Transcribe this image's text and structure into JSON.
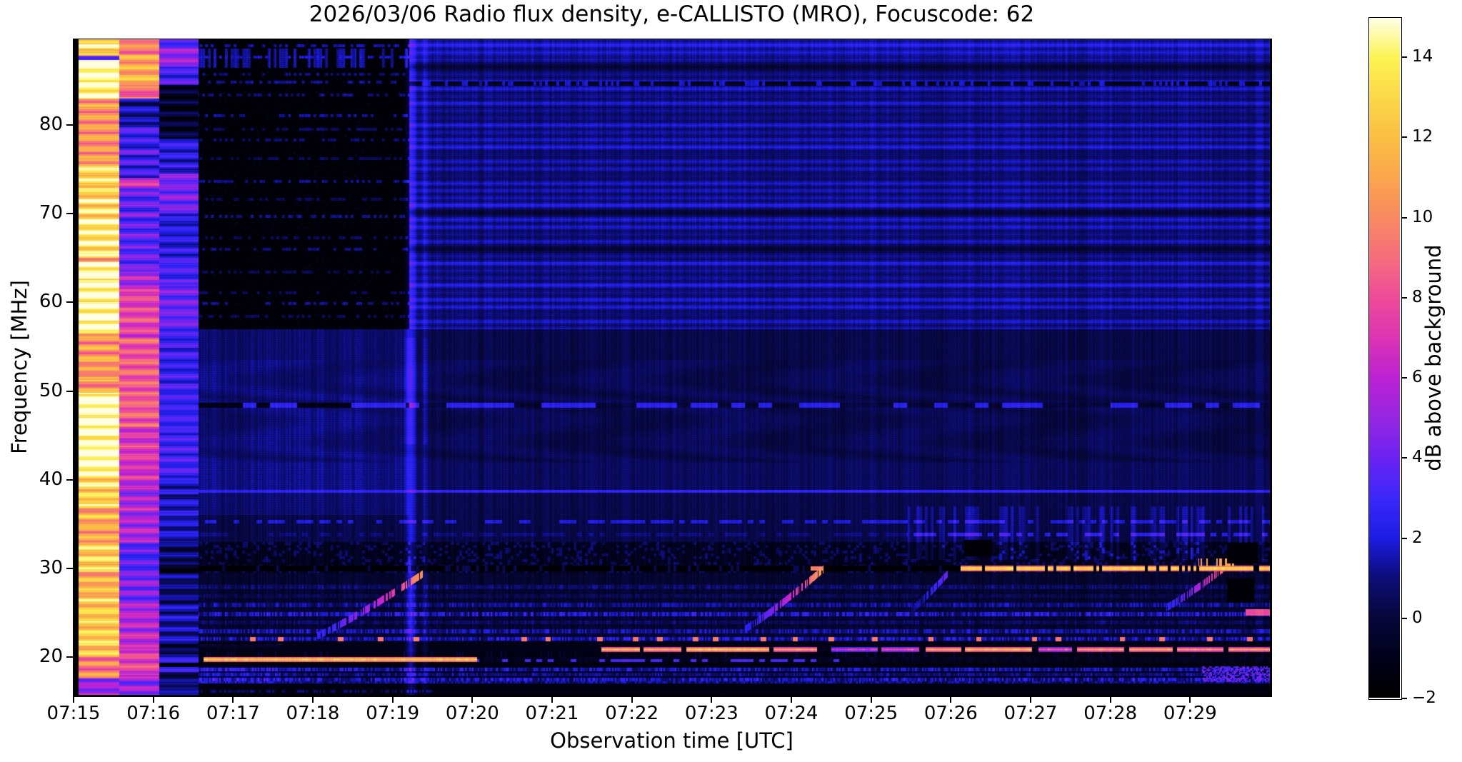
{
  "title": "2026/03/06  Radio flux density, e-CALLISTO (MRO), Focuscode: 62",
  "xlabel": "Observation time [UTC]",
  "ylabel": "Frequency [MHz]",
  "colorbar_label": "dB above background",
  "chart_data": {
    "type": "heatmap",
    "subtype": "solar-radio-spectrogram",
    "title": "2026/03/06  Radio flux density, e-CALLISTO (MRO), Focuscode: 62",
    "date": "2026/03/06",
    "station": "MRO",
    "focuscode": "62",
    "x": {
      "label": "Observation time [UTC]",
      "start_min": 0,
      "end_min": 15,
      "tick_labels": [
        "07:15",
        "07:16",
        "07:17",
        "07:18",
        "07:19",
        "07:20",
        "07:21",
        "07:22",
        "07:23",
        "07:24",
        "07:25",
        "07:26",
        "07:27",
        "07:28",
        "07:29"
      ],
      "tick_minutes": [
        0,
        1,
        2,
        3,
        4,
        5,
        6,
        7,
        8,
        9,
        10,
        11,
        12,
        13,
        14
      ]
    },
    "y": {
      "label": "Frequency [MHz]",
      "top_mhz": 89.65,
      "bottom_mhz": 15.75,
      "ticks": [
        20,
        30,
        40,
        50,
        60,
        70,
        80
      ]
    },
    "z": {
      "label": "dB above background",
      "min": -2,
      "max": 15,
      "ticks": [
        {
          "v": 14,
          "label": "14"
        },
        {
          "v": 12,
          "label": "12"
        },
        {
          "v": 10,
          "label": "10"
        },
        {
          "v": 8,
          "label": "8"
        },
        {
          "v": 6,
          "label": "6"
        },
        {
          "v": 4,
          "label": "4"
        },
        {
          "v": 2,
          "label": "2"
        },
        {
          "v": 0,
          "label": "0"
        },
        {
          "v": -2,
          "label": "−2"
        }
      ],
      "colormap_stops": [
        [
          -2,
          "#000000"
        ],
        [
          -1,
          "#02021a"
        ],
        [
          0,
          "#07073c"
        ],
        [
          1,
          "#0d0d7a"
        ],
        [
          2,
          "#1d1de4"
        ],
        [
          3,
          "#3c28fa"
        ],
        [
          4,
          "#6c23f2"
        ],
        [
          5,
          "#9727e2"
        ],
        [
          6,
          "#bc22d4"
        ],
        [
          7,
          "#dc35b4"
        ],
        [
          8,
          "#ee4b9a"
        ],
        [
          9,
          "#f66e7e"
        ],
        [
          10,
          "#f98a62"
        ],
        [
          11,
          "#fba64e"
        ],
        [
          12,
          "#fbbf44"
        ],
        [
          13,
          "#fcd84a"
        ],
        [
          14,
          "#fdf452"
        ],
        [
          15,
          "#ffffe6"
        ]
      ]
    },
    "data_start_min": 0.063,
    "calibration_columns": [
      {
        "name": "saturated-bright",
        "t0": 0.063,
        "t1": 0.575,
        "bands": [
          [
            89.1,
            89.7,
            11.5
          ],
          [
            88.5,
            89.1,
            15
          ],
          [
            87.8,
            88.5,
            11
          ],
          [
            87.3,
            87.8,
            4
          ],
          [
            84.6,
            87.3,
            15
          ],
          [
            84.1,
            84.6,
            13.5
          ],
          [
            83.0,
            84.1,
            15
          ],
          [
            75.6,
            83.0,
            10.5
          ],
          [
            69.8,
            75.6,
            13
          ],
          [
            65.0,
            69.8,
            13.5
          ],
          [
            64.5,
            65.0,
            11
          ],
          [
            56.5,
            64.5,
            15
          ],
          [
            49.8,
            56.5,
            10.5
          ],
          [
            40.5,
            49.8,
            15
          ],
          [
            36.9,
            40.5,
            13
          ],
          [
            32.9,
            36.9,
            11
          ],
          [
            29.6,
            32.9,
            12.5
          ],
          [
            27.2,
            29.6,
            11
          ],
          [
            20.0,
            27.2,
            12.5
          ],
          [
            17.6,
            20.0,
            9.5
          ],
          [
            15.7,
            17.6,
            5
          ]
        ]
      },
      {
        "name": "medium-bright",
        "t0": 0.575,
        "t1": 1.075,
        "bands": [
          [
            87.9,
            89.7,
            9.5
          ],
          [
            86.0,
            87.9,
            11
          ],
          [
            84.5,
            86.0,
            11.5
          ],
          [
            83.0,
            84.5,
            9
          ],
          [
            80.0,
            83.0,
            1.2
          ],
          [
            74.0,
            80.0,
            2.8
          ],
          [
            72.8,
            74.0,
            6.5
          ],
          [
            63.5,
            72.8,
            3.5
          ],
          [
            61.5,
            63.5,
            5.5
          ],
          [
            56.0,
            61.5,
            7.5
          ],
          [
            46.0,
            56.0,
            8.5
          ],
          [
            40.0,
            46.0,
            7
          ],
          [
            33.0,
            40.0,
            5.5
          ],
          [
            29.5,
            33.0,
            3.5
          ],
          [
            26.0,
            29.5,
            4.5
          ],
          [
            21.0,
            26.0,
            6
          ],
          [
            18.0,
            21.0,
            7.5
          ],
          [
            15.7,
            18.0,
            5
          ]
        ]
      },
      {
        "name": "faint-blue",
        "t0": 1.075,
        "t1": 1.567,
        "bands": [
          [
            88.6,
            89.7,
            3.5
          ],
          [
            86.5,
            88.6,
            5
          ],
          [
            84.5,
            86.5,
            3
          ],
          [
            78.5,
            84.5,
            -0.5
          ],
          [
            74.5,
            78.5,
            2.2
          ],
          [
            70.0,
            74.5,
            4.2
          ],
          [
            65.0,
            70.0,
            2.2
          ],
          [
            62.0,
            65.0,
            3.2
          ],
          [
            57.0,
            62.0,
            4
          ],
          [
            40.0,
            57.0,
            2.8
          ],
          [
            33.0,
            40.0,
            1.8
          ],
          [
            30.5,
            33.0,
            0.5
          ],
          [
            29.5,
            30.5,
            -1.2
          ],
          [
            26.0,
            29.5,
            0.8
          ],
          [
            21.5,
            26.0,
            1.5
          ],
          [
            20.3,
            21.5,
            -0.5
          ],
          [
            19.4,
            20.3,
            2.2
          ],
          [
            18.9,
            19.4,
            -0.8
          ],
          [
            18.3,
            18.9,
            2.5
          ],
          [
            17.0,
            18.3,
            0.3
          ],
          [
            15.7,
            17.0,
            1.2
          ]
        ]
      }
    ],
    "quiet_black_zone": {
      "t0": 1.567,
      "t1": 4.205,
      "f_min": 57,
      "f_max": 90,
      "level": -1.7
    },
    "upper_left_dotted_rows": [
      {
        "f": 88.9,
        "v": 1.5
      },
      {
        "f": 87.6,
        "v": 1.8
      },
      {
        "f": 85.7,
        "v": 1.0
      },
      {
        "f": 84.8,
        "v": 1.3
      },
      {
        "f": 83.4,
        "v": 1.1
      },
      {
        "f": 81.0,
        "v": 1.4
      },
      {
        "f": 79.5,
        "v": 0.7
      },
      {
        "f": 78.3,
        "v": 0.9
      },
      {
        "f": 76.2,
        "v": 0.5
      },
      {
        "f": 73.6,
        "v": 1.2
      },
      {
        "f": 71.6,
        "v": 0.5
      },
      {
        "f": 69.7,
        "v": 1.3
      },
      {
        "f": 67.3,
        "v": 0.6
      },
      {
        "f": 66.0,
        "v": 1.0
      },
      {
        "f": 63.4,
        "v": 0.5
      },
      {
        "f": 61.1,
        "v": 0.6
      },
      {
        "f": 59.9,
        "v": 1.2
      },
      {
        "f": 58.4,
        "v": 0.6
      }
    ],
    "upper_right_stripes": {
      "t0": 4.205,
      "f_min": 57,
      "f_max": 89.6,
      "spacing_mhz": 0.82,
      "base_level": 0.5,
      "amp_min": 0.3,
      "amp_max": 1.95
    },
    "mid_band_wavy": {
      "f_min": 42,
      "f_max": 53.5,
      "base_left": 1.1,
      "base_right": 0.55,
      "arc_depth": 0.5
    },
    "rfi_row_48": {
      "f": 48.4,
      "dash_period_min": 0.17,
      "left_level": 2.6,
      "right_level": 2.4
    },
    "light_row_38_7": {
      "f": 38.7,
      "v": 2.6
    },
    "dashed_rows": [
      {
        "f": 35.3,
        "v": 2.0,
        "t0": 1.6
      },
      {
        "f": 33.8,
        "v": 2.4,
        "t0": 10.45,
        "v_before": 1.0
      }
    ],
    "dark_row_30": {
      "f_min": 29.7,
      "f_max": 30.35,
      "level": -1.85
    },
    "speckle_rows_low": [
      {
        "f": 27.9,
        "v": 1.0
      },
      {
        "f": 26.9,
        "v": 0.7
      },
      {
        "f": 25.9,
        "v": 1.4
      },
      {
        "f": 24.85,
        "v": 2.0
      },
      {
        "f": 23.9,
        "v": 0.9
      },
      {
        "f": 22.9,
        "v": 1.6
      },
      {
        "f": 22.05,
        "v": 1.9
      },
      {
        "f": 18.6,
        "v": 1.8
      },
      {
        "f": 18.05,
        "v": 1.2
      },
      {
        "f": 17.5,
        "v": 1.9
      },
      {
        "f": 17.15,
        "v": 1.3
      }
    ],
    "vertical_streaks": [
      {
        "t": 4.225,
        "w": 0.09,
        "dv": 2.2
      },
      {
        "t": 4.41,
        "w": 0.055,
        "dv": 0.9
      }
    ],
    "drifting_bursts": [
      {
        "t0": 3.05,
        "f0": 22.4,
        "t1": 4.4,
        "f1": 29.5,
        "vmax": 10.5
      },
      {
        "t0": 8.42,
        "f0": 23.2,
        "t1": 9.4,
        "f1": 29.9,
        "vmax": 11.0
      },
      {
        "t0": 13.7,
        "f0": 25.6,
        "t1": 14.48,
        "f1": 30.4,
        "vmax": 10.0
      },
      {
        "t0": 10.5,
        "f0": 25.3,
        "t1": 10.98,
        "f1": 29.6,
        "vmax": 3.2,
        "faint": true
      }
    ],
    "rfi_lines": {
      "line_19_8": {
        "f": 19.75,
        "t0": 1.63,
        "t1": 5.06,
        "v": 12.2
      },
      "line_19_6_faint": {
        "f": 19.6,
        "t0": 5.06,
        "t1": 9.6,
        "v": 3.2
      },
      "line_20_9_segments": [
        [
          6.62,
          7.1,
          11.5
        ],
        [
          7.15,
          7.62,
          11.0
        ],
        [
          7.68,
          8.72,
          12.0
        ],
        [
          8.78,
          9.32,
          10.5
        ],
        [
          9.5,
          10.08,
          6.5
        ],
        [
          10.13,
          10.6,
          7.5
        ],
        [
          10.68,
          11.13,
          11.0
        ],
        [
          11.18,
          12.02,
          11.5
        ],
        [
          12.1,
          12.52,
          8.0
        ],
        [
          12.58,
          13.17,
          10.5
        ],
        [
          13.24,
          13.78,
          11.0
        ],
        [
          13.84,
          14.42,
          10.0
        ],
        [
          14.48,
          15.0,
          10.5
        ]
      ],
      "line_30": {
        "f": 30.0,
        "t0": 11.12,
        "t1": 15.0,
        "v": 12.6
      },
      "line_30_short": {
        "f": 30.0,
        "t0": 9.24,
        "t1": 9.4,
        "v": 9.5
      }
    },
    "dot_row_22": {
      "f": 22.0,
      "v": 9.5,
      "times": [
        2.25,
        2.6,
        3.35,
        3.85,
        4.3,
        5.65,
        5.95,
        6.6,
        7.05,
        7.35,
        7.8,
        8.05,
        8.65,
        9.05,
        9.5,
        10.05,
        10.75,
        11.35,
        12.05,
        12.35,
        13.15,
        13.65,
        14.25,
        14.75
      ]
    },
    "black_patches": [
      {
        "t": [
          14.46,
          14.85
        ],
        "f": [
          30.6,
          32.9
        ]
      },
      {
        "t": [
          14.46,
          14.8
        ],
        "f": [
          26.1,
          28.9
        ]
      },
      {
        "t": [
          11.17,
          11.52
        ],
        "f": [
          31.4,
          33.2
        ]
      }
    ],
    "bright_patches": [
      {
        "t": [
          14.7,
          15.0
        ],
        "f": [
          24.7,
          25.4
        ],
        "v": 8.0
      },
      {
        "t": [
          14.15,
          15.0
        ],
        "f": [
          17.2,
          19.0
        ],
        "v": 3.6,
        "speckle": true
      }
    ],
    "right_speckle_band": {
      "t0": 10.45,
      "f_min": 31.0,
      "f_max": 37.0,
      "boost": 1.1
    }
  }
}
